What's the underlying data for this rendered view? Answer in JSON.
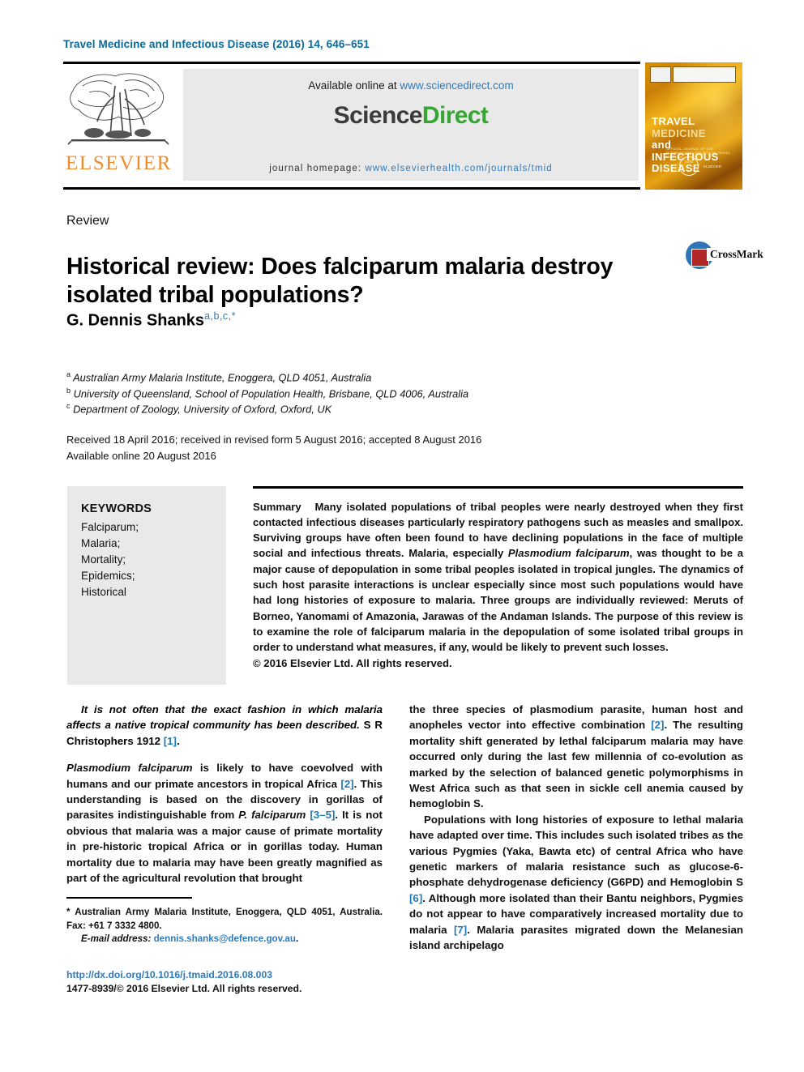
{
  "running_head": "Travel Medicine and Infectious Disease (2016) 14, 646–651",
  "masthead": {
    "elsevier_wordmark": "ELSEVIER",
    "available_prefix": "Available online at ",
    "available_url": "www.sciencedirect.com",
    "sciencedirect_part1": "Science",
    "sciencedirect_part2": "Direct",
    "homepage_label": "journal homepage: ",
    "homepage_url": "www.elsevierhealth.com/journals/tmid",
    "cover": {
      "line1": "TRAVEL",
      "line1b": "MEDICINE",
      "line2": "and INFECTIOUS",
      "line3": "DISEASE",
      "subtitle": "OFFICIAL JOURNAL OF THE INTERNATIONAL SOCIETY OF TRAVEL MEDICINE",
      "seal": "ISTM",
      "publisher": "ELSEVIER"
    }
  },
  "article": {
    "section_label": "Review",
    "title": "Historical review: Does falciparum malaria destroy isolated tribal populations?",
    "author": "G. Dennis Shanks",
    "author_marks": "a,b,c,*",
    "crossmark_label": "CrossMark",
    "affiliations": [
      {
        "mark": "a",
        "text": "Australian Army Malaria Institute, Enoggera, QLD 4051, Australia"
      },
      {
        "mark": "b",
        "text": "University of Queensland, School of Population Health, Brisbane, QLD 4006, Australia"
      },
      {
        "mark": "c",
        "text": "Department of Zoology, University of Oxford, Oxford, UK"
      }
    ],
    "history_line1": "Received 18 April 2016; received in revised form 5 August 2016; accepted 8 August 2016",
    "history_line2": "Available online 20 August 2016"
  },
  "keywords": {
    "heading": "KEYWORDS",
    "items": [
      "Falciparum;",
      "Malaria;",
      "Mortality;",
      "Epidemics;",
      "Historical"
    ]
  },
  "abstract": {
    "label": "Summary",
    "text_part1": "Many isolated populations of tribal peoples were nearly destroyed when they first contacted infectious diseases particularly respiratory pathogens such as measles and smallpox. Surviving groups have often been found to have declining populations in the face of multiple social and infectious threats. Malaria, especially ",
    "italic_species": "Plasmodium falciparum",
    "text_part2": ", was thought to be a major cause of depopulation in some tribal peoples isolated in tropical jungles. The dynamics of such host parasite interactions is unclear especially since most such populations would have had long histories of exposure to malaria. Three groups are individually reviewed: Meruts of Borneo, Yanomami of Amazonia, Jarawas of the Andaman Islands. The purpose of this review is to examine the role of falciparum malaria in the depopulation of some isolated tribal groups in order to understand what measures, if any, would be likely to prevent such losses.",
    "copyright": "© 2016 Elsevier Ltd. All rights reserved."
  },
  "body": {
    "epigraph_text": "It is not often that the exact fashion in which malaria affects a native tropical community has been described.",
    "epigraph_attrib": "S R Christophers 1912 ",
    "epigraph_ref": "[1]",
    "epigraph_end": ".",
    "left_p1_a": "Plasmodium falciparum",
    "left_p1_b": " is likely to have coevolved with humans and our primate ancestors in tropical Africa ",
    "left_p1_ref1": "[2]",
    "left_p1_c": ". This understanding is based on the discovery in gorillas of parasites indistinguishable from ",
    "left_p1_d": "P. falciparum",
    "left_p1_ref2": "[3–5]",
    "left_p1_e": ". It is not obvious that malaria was a major cause of primate mortality in pre-historic tropical Africa or in gorillas today. Human mortality due to malaria may have been greatly magnified as part of the agricultural revolution that brought",
    "right_p1_a": "the three species of plasmodium parasite, human host and anopheles vector into effective combination ",
    "right_p1_ref": "[2]",
    "right_p1_b": ". The resulting mortality shift generated by lethal falciparum malaria may have occurred only during the last few millennia of co-evolution as marked by the selection of balanced genetic polymorphisms in West Africa such as that seen in sickle cell anemia caused by hemoglobin S.",
    "right_p2_a": "Populations with long histories of exposure to lethal malaria have adapted over time. This includes such isolated tribes as the various Pygmies (Yaka, Bawta etc) of central Africa who have genetic markers of malaria resistance such as glucose-6-phosphate dehydrogenase deficiency (G6PD) and Hemoglobin S ",
    "right_p2_ref1": "[6]",
    "right_p2_b": ". Although more isolated than their Bantu neighbors, Pygmies do not appear to have comparatively increased mortality due to malaria ",
    "right_p2_ref2": "[7]",
    "right_p2_c": ". Malaria parasites migrated down the Melanesian island archipelago"
  },
  "footnotes": {
    "corresponding": "* Australian Army Malaria Institute, Enoggera, QLD 4051, Australia. Fax: +61 7 3332 4800.",
    "email_label": "E-mail address: ",
    "email_address": "dennis.shanks@defence.gov.au",
    "email_end": ".",
    "doi_url": "http://dx.doi.org/10.1016/j.tmaid.2016.08.003",
    "issn_line": "1477-8939/© 2016 Elsevier Ltd. All rights reserved."
  }
}
